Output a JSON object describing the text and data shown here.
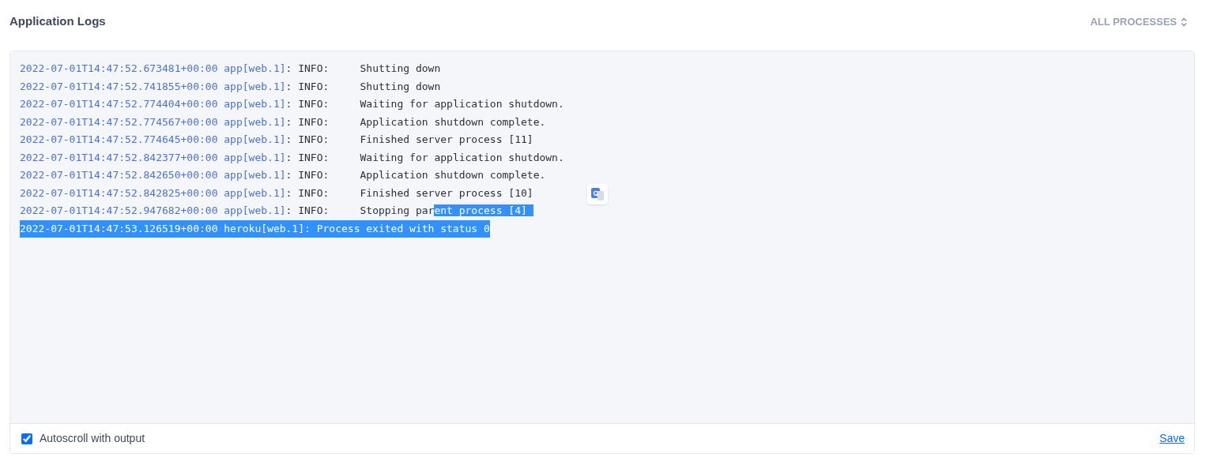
{
  "header": {
    "title": "Application Logs",
    "filter": "ALL PROCESSES"
  },
  "log_lines": [
    {
      "timestamp": "2022-07-01T14:47:52.673481+00:00",
      "source": "app[web.1]",
      "message": ": INFO:     Shutting down",
      "selected": false
    },
    {
      "timestamp": "2022-07-01T14:47:52.741855+00:00",
      "source": "app[web.1]",
      "message": ": INFO:     Shutting down",
      "selected": false
    },
    {
      "timestamp": "2022-07-01T14:47:52.774404+00:00",
      "source": "app[web.1]",
      "message": ": INFO:     Waiting for application shutdown.",
      "selected": false
    },
    {
      "timestamp": "2022-07-01T14:47:52.774567+00:00",
      "source": "app[web.1]",
      "message": ": INFO:     Application shutdown complete.",
      "selected": false
    },
    {
      "timestamp": "2022-07-01T14:47:52.774645+00:00",
      "source": "app[web.1]",
      "message": ": INFO:     Finished server process [11]",
      "selected": false
    },
    {
      "timestamp": "2022-07-01T14:47:52.842377+00:00",
      "source": "app[web.1]",
      "message": ": INFO:     Waiting for application shutdown.",
      "selected": false
    },
    {
      "timestamp": "2022-07-01T14:47:52.842650+00:00",
      "source": "app[web.1]",
      "message": ": INFO:     Application shutdown complete.",
      "selected": false
    },
    {
      "timestamp": "2022-07-01T14:47:52.842825+00:00",
      "source": "app[web.1]",
      "message": ": INFO:     Finished server process [10]",
      "selected": false
    },
    {
      "timestamp": "2022-07-01T14:47:52.947682+00:00",
      "source": "app[web.1]",
      "message": ": INFO:     Stopping par",
      "selected": false,
      "selected_tail": "ent process [4]"
    },
    {
      "timestamp": "2022-07-01T14:47:53.126519+00:00",
      "source": "heroku[web.1]",
      "message": ": Process exited with status 0",
      "selected": true
    }
  ],
  "footer": {
    "autoscroll": {
      "label": "Autoscroll with output",
      "checked": true
    },
    "save": "Save"
  }
}
